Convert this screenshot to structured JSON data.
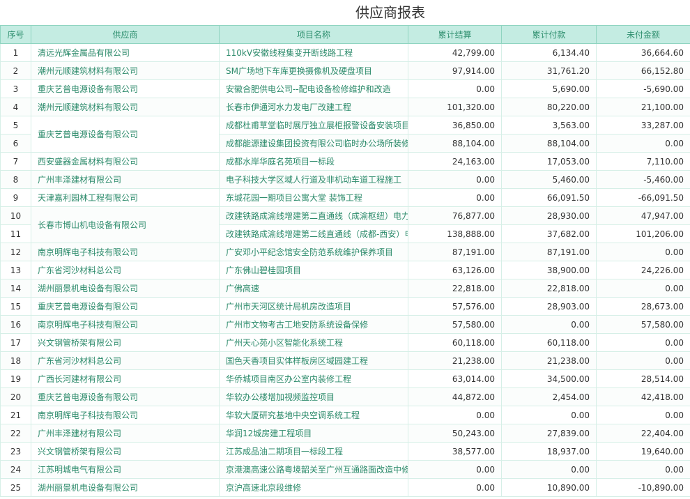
{
  "title": "供应商报表",
  "columns": [
    "序号",
    "供应商",
    "项目名称",
    "累计结算",
    "累计付款",
    "未付金额"
  ],
  "rows": [
    {
      "no": "1",
      "supplier": "清远光辉金属品有限公司",
      "project": "110kV安徽线程集变开断线路工程",
      "settle": "42,799.00",
      "paid": "6,134.40",
      "unpaid": "36,664.60"
    },
    {
      "no": "2",
      "supplier": "潮州元顺建筑材料有限公司",
      "project": "SM广场地下车库更换摄像机及硬盘项目",
      "settle": "97,914.00",
      "paid": "31,761.20",
      "unpaid": "66,152.80"
    },
    {
      "no": "3",
      "supplier": "重庆艺普电源设备有限公司",
      "project": "安徽合肥供电公司--配电设备检修维护和改造",
      "settle": "0.00",
      "paid": "5,690.00",
      "unpaid": "-5,690.00"
    },
    {
      "no": "4",
      "supplier": "潮州元顺建筑材料有限公司",
      "project": "长春市伊通河水力发电厂改建工程",
      "settle": "101,320.00",
      "paid": "80,220.00",
      "unpaid": "21,100.00"
    },
    {
      "no": "5",
      "supplier": "重庆艺普电源设备有限公司",
      "project": "成都杜甫草堂临时展厅独立展柜报警设备安装项目",
      "settle": "36,850.00",
      "paid": "3,563.00",
      "unpaid": "33,287.00",
      "rowspan": 2
    },
    {
      "no": "6",
      "supplier": "",
      "project": "成都能源建设集团投资有限公司临时办公场所装修",
      "settle": "88,104.00",
      "paid": "88,104.00",
      "unpaid": "0.00",
      "skip": true
    },
    {
      "no": "7",
      "supplier": "西安盛器金属材料有限公司",
      "project": "成都水岸华庭名苑项目一标段",
      "settle": "24,163.00",
      "paid": "17,053.00",
      "unpaid": "7,110.00"
    },
    {
      "no": "8",
      "supplier": "广州丰泽建材有限公司",
      "project": "电子科技大学区域人行道及非机动车道工程施工",
      "settle": "0.00",
      "paid": "5,460.00",
      "unpaid": "-5,460.00"
    },
    {
      "no": "9",
      "supplier": "天津嘉利园林工程有限公司",
      "project": "东城花园一期项目公寓大堂 装饰工程",
      "settle": "0.00",
      "paid": "66,091.50",
      "unpaid": "-66,091.50"
    },
    {
      "no": "10",
      "supplier": "长春市博山机电设备有限公司",
      "project": "改建铁路成渝线增建第二直通线（成渝枢纽）电力",
      "settle": "76,877.00",
      "paid": "28,930.00",
      "unpaid": "47,947.00",
      "rowspan": 2
    },
    {
      "no": "11",
      "supplier": "",
      "project": "改建铁路成渝线增建第二线直通线（成都-西安）电力线",
      "settle": "138,888.00",
      "paid": "37,682.00",
      "unpaid": "101,206.00",
      "skip": true
    },
    {
      "no": "12",
      "supplier": "南京明辉电子科技有限公司",
      "project": "广安邓小平纪念馆安全防范系统维护保养项目",
      "settle": "87,191.00",
      "paid": "87,191.00",
      "unpaid": "0.00"
    },
    {
      "no": "13",
      "supplier": "广东省河沙材料总公司",
      "project": "广东佛山碧桂园项目",
      "settle": "63,126.00",
      "paid": "38,900.00",
      "unpaid": "24,226.00"
    },
    {
      "no": "14",
      "supplier": "湖州丽景机电设备有限公司",
      "project": "广佛高速",
      "settle": "22,818.00",
      "paid": "22,818.00",
      "unpaid": "0.00"
    },
    {
      "no": "15",
      "supplier": "重庆艺普电源设备有限公司",
      "project": "广州市天河区统计局机房改造项目",
      "settle": "57,576.00",
      "paid": "28,903.00",
      "unpaid": "28,673.00"
    },
    {
      "no": "16",
      "supplier": "南京明辉电子科技有限公司",
      "project": "广州市文物考古工地安防系统设备保修",
      "settle": "57,580.00",
      "paid": "0.00",
      "unpaid": "57,580.00"
    },
    {
      "no": "17",
      "supplier": "兴文钢管桥架有限公司",
      "project": "广州天心苑小区智能化系统工程",
      "settle": "60,118.00",
      "paid": "60,118.00",
      "unpaid": "0.00"
    },
    {
      "no": "18",
      "supplier": "广东省河沙材料总公司",
      "project": "国色天香项目实体样板房区域园建工程",
      "settle": "21,238.00",
      "paid": "21,238.00",
      "unpaid": "0.00"
    },
    {
      "no": "19",
      "supplier": "广西长河建材有限公司",
      "project": "华侨城项目南区办公室内装修工程",
      "settle": "63,014.00",
      "paid": "34,500.00",
      "unpaid": "28,514.00"
    },
    {
      "no": "20",
      "supplier": "重庆艺普电源设备有限公司",
      "project": "华软办公楼增加视频监控项目",
      "settle": "44,872.00",
      "paid": "2,454.00",
      "unpaid": "42,418.00"
    },
    {
      "no": "21",
      "supplier": "南京明辉电子科技有限公司",
      "project": "华软大厦研究基地中央空调系统工程",
      "settle": "0.00",
      "paid": "0.00",
      "unpaid": "0.00"
    },
    {
      "no": "22",
      "supplier": "广州丰泽建材有限公司",
      "project": "华润12城房建工程项目",
      "settle": "50,243.00",
      "paid": "27,839.00",
      "unpaid": "22,404.00"
    },
    {
      "no": "23",
      "supplier": "兴文钢管桥架有限公司",
      "project": "江苏成品油二期项目一标段工程",
      "settle": "38,577.00",
      "paid": "18,937.00",
      "unpaid": "19,640.00"
    },
    {
      "no": "24",
      "supplier": "江苏明城电气有限公司",
      "project": "京港澳高速公路粤境韶关至广州互通路面改造中修",
      "settle": "0.00",
      "paid": "0.00",
      "unpaid": "0.00"
    },
    {
      "no": "25",
      "supplier": "湖州丽景机电设备有限公司",
      "project": "京沪高速北京段维修",
      "settle": "0.00",
      "paid": "10,890.00",
      "unpaid": "-10,890.00"
    }
  ]
}
